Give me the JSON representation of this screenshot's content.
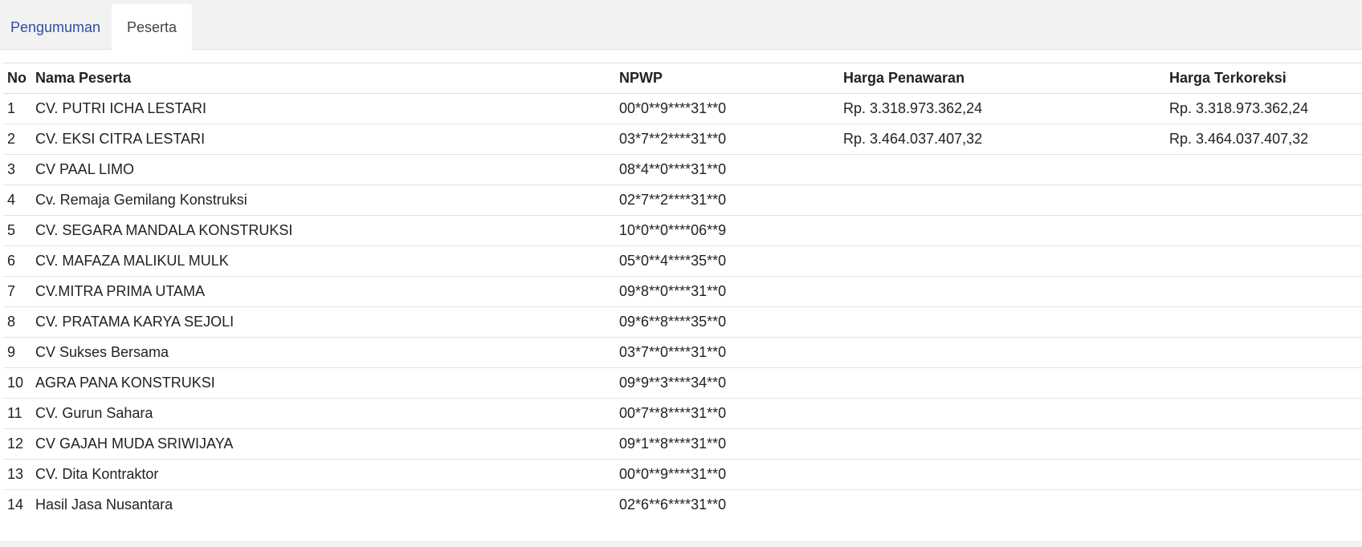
{
  "tabs": [
    {
      "label": "Pengumuman",
      "active": false
    },
    {
      "label": "Peserta",
      "active": true
    }
  ],
  "table": {
    "headers": {
      "no": "No",
      "nama": "Nama Peserta",
      "npwp": "NPWP",
      "harga": "Harga Penawaran",
      "terkoreksi": "Harga Terkoreksi"
    },
    "rows": [
      {
        "no": "1",
        "nama": "CV. PUTRI ICHA LESTARI",
        "npwp": "00*0**9****31**0",
        "harga": "Rp. 3.318.973.362,24",
        "terkoreksi": "Rp. 3.318.973.362,24"
      },
      {
        "no": "2",
        "nama": "CV. EKSI CITRA LESTARI",
        "npwp": "03*7**2****31**0",
        "harga": "Rp. 3.464.037.407,32",
        "terkoreksi": "Rp. 3.464.037.407,32"
      },
      {
        "no": "3",
        "nama": "CV PAAL LIMO",
        "npwp": "08*4**0****31**0",
        "harga": "",
        "terkoreksi": ""
      },
      {
        "no": "4",
        "nama": "Cv. Remaja Gemilang Konstruksi",
        "npwp": "02*7**2****31**0",
        "harga": "",
        "terkoreksi": ""
      },
      {
        "no": "5",
        "nama": "CV. SEGARA MANDALA KONSTRUKSI",
        "npwp": "10*0**0****06**9",
        "harga": "",
        "terkoreksi": ""
      },
      {
        "no": "6",
        "nama": "CV. MAFAZA MALIKUL MULK",
        "npwp": "05*0**4****35**0",
        "harga": "",
        "terkoreksi": ""
      },
      {
        "no": "7",
        "nama": "CV.MITRA PRIMA UTAMA",
        "npwp": "09*8**0****31**0",
        "harga": "",
        "terkoreksi": ""
      },
      {
        "no": "8",
        "nama": "CV. PRATAMA KARYA SEJOLI",
        "npwp": "09*6**8****35**0",
        "harga": "",
        "terkoreksi": ""
      },
      {
        "no": "9",
        "nama": "CV Sukses Bersama",
        "npwp": "03*7**0****31**0",
        "harga": "",
        "terkoreksi": ""
      },
      {
        "no": "10",
        "nama": "AGRA PANA KONSTRUKSI",
        "npwp": "09*9**3****34**0",
        "harga": "",
        "terkoreksi": ""
      },
      {
        "no": "11",
        "nama": "CV. Gurun Sahara",
        "npwp": "00*7**8****31**0",
        "harga": "",
        "terkoreksi": ""
      },
      {
        "no": "12",
        "nama": "CV GAJAH MUDA SRIWIJAYA",
        "npwp": "09*1**8****31**0",
        "harga": "",
        "terkoreksi": ""
      },
      {
        "no": "13",
        "nama": "CV. Dita Kontraktor",
        "npwp": "00*0**9****31**0",
        "harga": "",
        "terkoreksi": ""
      },
      {
        "no": "14",
        "nama": "Hasil Jasa Nusantara",
        "npwp": "02*6**6****31**0",
        "harga": "",
        "terkoreksi": ""
      }
    ]
  },
  "colors": {
    "tab_link": "#2f4fa3",
    "tabbar_bg": "#f2f2f2",
    "border": "#dddddd"
  }
}
